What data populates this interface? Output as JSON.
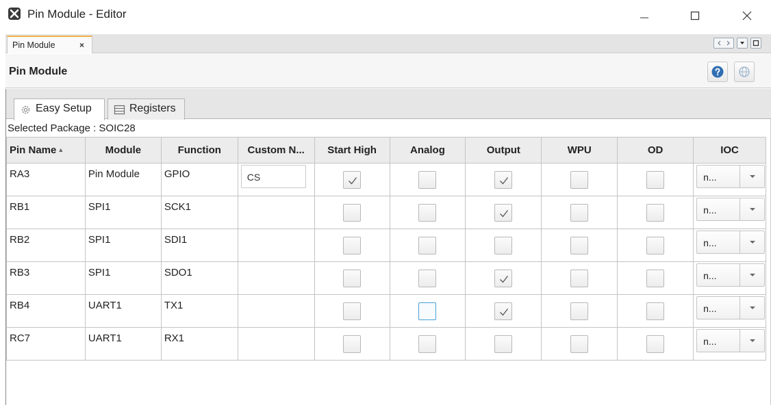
{
  "window": {
    "title": "Pin Module - Editor",
    "minimize_label": "—",
    "maximize_label": "☐",
    "close_label": "✕"
  },
  "editor_tab": {
    "label": "Pin Module",
    "close_label": "×"
  },
  "header": {
    "title": "Pin Module",
    "help_icon": "help-icon",
    "globe_icon": "globe-icon"
  },
  "subtabs": [
    {
      "label": "Easy Setup",
      "icon": "gear-icon",
      "active": true
    },
    {
      "label": "Registers",
      "icon": "list-icon",
      "active": false
    }
  ],
  "package": {
    "label": "Selected Package : SOIC28"
  },
  "table": {
    "columns": [
      "Pin Name",
      "Module",
      "Function",
      "Custom N...",
      "Start High",
      "Analog",
      "Output",
      "WPU",
      "OD",
      "IOC"
    ],
    "rows": [
      {
        "pin": "RA3",
        "module": "Pin Module",
        "function": "GPIO",
        "custom": "CS",
        "start_high": true,
        "analog": false,
        "output": true,
        "wpu": false,
        "od": false,
        "ioc": "n..."
      },
      {
        "pin": "RB1",
        "module": "SPI1",
        "function": "SCK1",
        "custom": "",
        "start_high": false,
        "analog": false,
        "output": true,
        "wpu": false,
        "od": false,
        "ioc": "n..."
      },
      {
        "pin": "RB2",
        "module": "SPI1",
        "function": "SDI1",
        "custom": "",
        "start_high": false,
        "analog": false,
        "output": false,
        "wpu": false,
        "od": false,
        "ioc": "n..."
      },
      {
        "pin": "RB3",
        "module": "SPI1",
        "function": "SDO1",
        "custom": "",
        "start_high": false,
        "analog": false,
        "output": true,
        "wpu": false,
        "od": false,
        "ioc": "n..."
      },
      {
        "pin": "RB4",
        "module": "UART1",
        "function": "TX1",
        "custom": "",
        "start_high": false,
        "analog": false,
        "output": true,
        "wpu": false,
        "od": false,
        "ioc": "n..."
      },
      {
        "pin": "RC7",
        "module": "UART1",
        "function": "RX1",
        "custom": "",
        "start_high": false,
        "analog": false,
        "output": false,
        "wpu": false,
        "od": false,
        "ioc": "n..."
      }
    ]
  },
  "colors": {
    "accent_tab": "#f2b24b",
    "help_blue": "#2f6fb3",
    "focus_border": "#4a9fd8"
  }
}
